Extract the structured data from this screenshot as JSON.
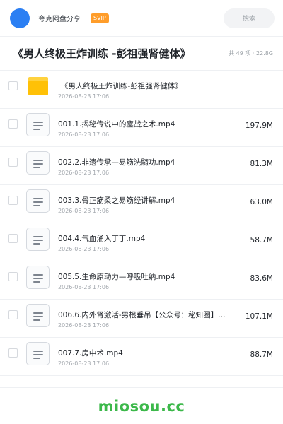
{
  "header": {
    "user_name": "夸克网盘分享",
    "badge": "SVIP",
    "search_label": "搜索"
  },
  "folder": {
    "title": "《男人终极王炸训练 -彭祖强肾健体》",
    "meta": "共 49 项 · 22.8G"
  },
  "items": [
    {
      "name": "《男人终极王炸训练-彭祖强肾健体》",
      "date": "2026-08-23 17:06",
      "size": "",
      "type": "folder"
    },
    {
      "name": "001.1.揭秘传说中的鏖战之术.mp4",
      "date": "2026-08-23 17:06",
      "size": "197.9M",
      "type": "file"
    },
    {
      "name": "002.2.非遗传承—易筋洗髓功.mp4",
      "date": "2026-08-23 17:06",
      "size": "81.3M",
      "type": "file"
    },
    {
      "name": "003.3.骨正筋柔之易筋经讲解.mp4",
      "date": "2026-08-23 17:06",
      "size": "63.0M",
      "type": "file"
    },
    {
      "name": "004.4.气血涌入丁丁.mp4",
      "date": "2026-08-23 17:06",
      "size": "58.7M",
      "type": "file"
    },
    {
      "name": "005.5.生命原动力—呼吸吐纳.mp4",
      "date": "2026-08-23 17:06",
      "size": "83.6M",
      "type": "file"
    },
    {
      "name": "006.6.内外肾激活-男根垂吊【公众号：秘知圈】…",
      "date": "2026-08-23 17:06",
      "size": "107.1M",
      "type": "file"
    },
    {
      "name": "007.7.房中术.mp4",
      "date": "2026-08-23 17:06",
      "size": "88.7M",
      "type": "file"
    }
  ],
  "footer": {
    "watermark": "miosou.cc"
  },
  "colors": {
    "accent": "#2b7ff3",
    "badge": "#ff9d2a",
    "folder": "#ffc107",
    "watermark": "#3cb84a"
  },
  "icons": {
    "folder": "folder-icon",
    "file": "document-icon"
  }
}
